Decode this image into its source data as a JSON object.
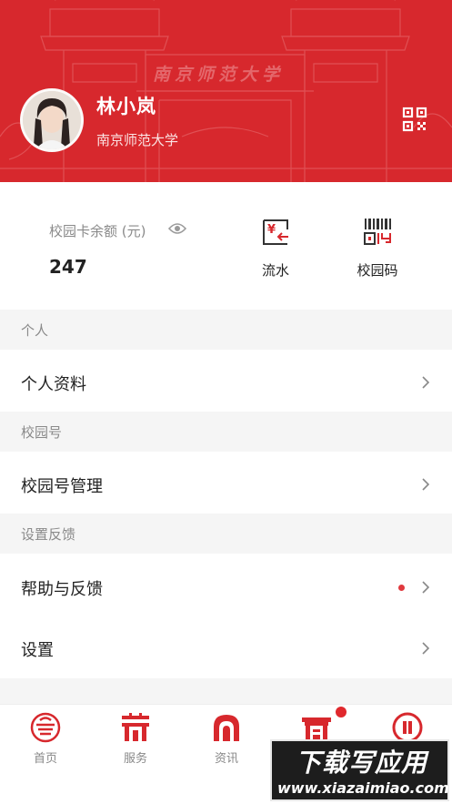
{
  "colors": {
    "brand": "#d7282d",
    "badge": "#e0393e"
  },
  "profile": {
    "name": "林小岚",
    "school": "南京师范大学",
    "gate_sign": "南京师范大学",
    "avatar_icon": "avatar",
    "qr_icon": "qr-code-icon"
  },
  "card": {
    "balance_label": "校园卡余额 (元)",
    "balance_value": "247",
    "eye_icon": "eye-icon",
    "actions": [
      {
        "label": "流水",
        "icon": "transaction-flow-icon"
      },
      {
        "label": "校园码",
        "icon": "barcode-icon"
      }
    ]
  },
  "sections": [
    {
      "header": "个人",
      "items": [
        {
          "label": "个人资料",
          "has_badge": false
        }
      ]
    },
    {
      "header": "校园号",
      "items": [
        {
          "label": "校园号管理",
          "has_badge": false
        }
      ]
    },
    {
      "header": "设置反馈",
      "items": [
        {
          "label": "帮助与反馈",
          "has_badge": true
        },
        {
          "label": "设置",
          "has_badge": false
        }
      ]
    }
  ],
  "tabbar": {
    "tabs": [
      {
        "label": "首页",
        "icon": "home-icon"
      },
      {
        "label": "服务",
        "icon": "service-icon"
      },
      {
        "label": "资讯",
        "icon": "news-icon"
      },
      {
        "label": "",
        "icon": "gate-icon",
        "has_badge": true
      },
      {
        "label": "",
        "icon": "profile-tab-icon"
      }
    ]
  },
  "watermark": {
    "title": "下载写应用",
    "url": "www.xiazaimiao.com"
  }
}
